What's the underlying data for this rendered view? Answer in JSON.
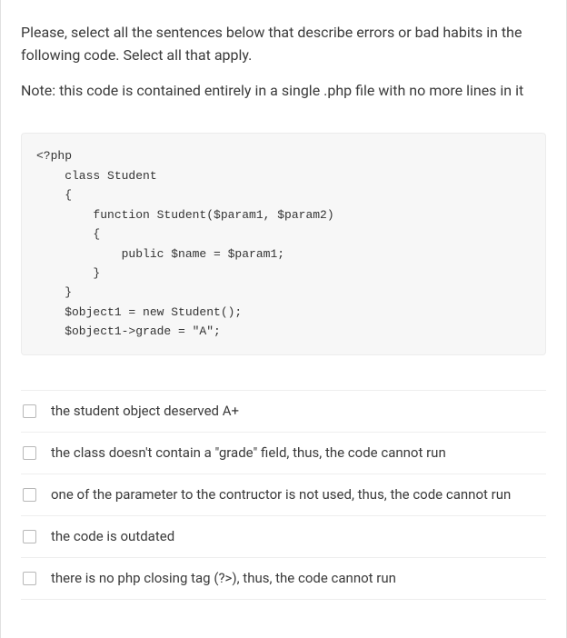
{
  "question": {
    "paragraph1": "Please, select all the sentences below that describe errors or bad habits in the following code. Select all that apply.",
    "paragraph2": "Note: this code is contained entirely in a single .php file with no more lines in it"
  },
  "code": "<?php\n    class Student\n    {\n        function Student($param1, $param2)\n        {\n            public $name = $param1;\n        }\n    }\n    $object1 = new Student();\n    $object1->grade = \"A\";",
  "options": [
    {
      "label": "the student object deserved A+"
    },
    {
      "label": "the class doesn't contain a \"grade\" field, thus, the code cannot run"
    },
    {
      "label": "one of the parameter to the contructor is not used, thus, the code cannot run"
    },
    {
      "label": "the code is outdated"
    },
    {
      "label": "there is no php closing tag (?>), thus, the code cannot run"
    }
  ]
}
